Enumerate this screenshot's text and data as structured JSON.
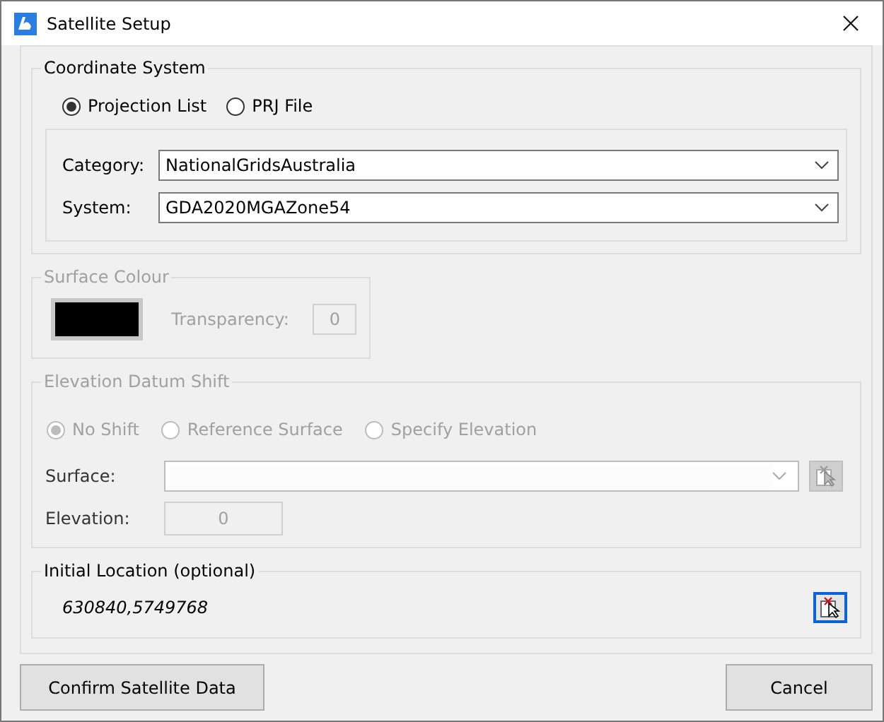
{
  "window": {
    "title": "Satellite Setup"
  },
  "coordinate_system": {
    "title": "Coordinate System",
    "options": [
      {
        "label": "Projection List",
        "selected": true
      },
      {
        "label": "PRJ File",
        "selected": false
      }
    ],
    "fields": [
      {
        "label": "Category:",
        "value": "NationalGridsAustralia"
      },
      {
        "label": "System:",
        "value": "GDA2020MGAZone54"
      }
    ]
  },
  "surface_colour": {
    "title": "Surface Colour",
    "disabled": true,
    "color": "#000000",
    "transparency_label": "Transparency:",
    "transparency_value": "0"
  },
  "elevation_datum_shift": {
    "title": "Elevation Datum Shift",
    "disabled": true,
    "options": [
      {
        "label": "No Shift",
        "selected": true
      },
      {
        "label": "Reference Surface",
        "selected": false
      },
      {
        "label": "Specify Elevation",
        "selected": false
      }
    ],
    "surface_label": "Surface:",
    "elevation_label": "Elevation:",
    "elevation_value": "0"
  },
  "initial_location": {
    "title": "Initial Location (optional)",
    "value": "630840,5749768"
  },
  "buttons": [
    {
      "label": "Confirm Satellite Data"
    },
    {
      "label": "Cancel"
    }
  ]
}
